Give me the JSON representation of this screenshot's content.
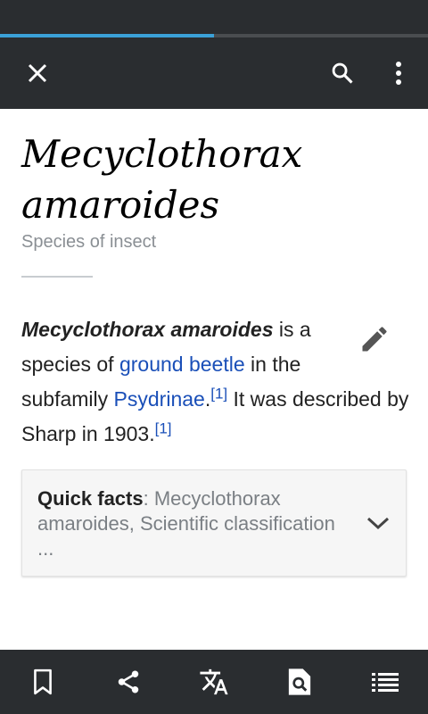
{
  "browser": {
    "load_progress_percent": 50
  },
  "toolbar": {
    "close_icon": "close-icon",
    "search_icon": "search-icon",
    "menu_icon": "more-vert-icon"
  },
  "article": {
    "title": "Mecyclothorax amaroides",
    "description": "Species of insect",
    "lead": {
      "bold_name": "Mecyclothorax amaroides",
      "text_1": " is a species of ",
      "link_1": "ground beetle",
      "text_2": " in the subfamily ",
      "link_2": "Psydrinae",
      "text_3": ".",
      "ref_1": "[1]",
      "text_4": " It was described by Sharp in 1903.",
      "ref_2": "[1]"
    },
    "edit_icon": "pencil-icon",
    "quick_facts": {
      "label": "Quick facts",
      "separator": ": ",
      "summary": "Mecyclothorax amaroides, Scientific classification ...",
      "expand_icon": "chevron-down-icon"
    }
  },
  "bottom_bar": {
    "icons": [
      "bookmark-icon",
      "share-icon",
      "translate-icon",
      "find-in-page-icon",
      "table-of-contents-icon"
    ]
  },
  "colors": {
    "bar_bg": "#2a2d30",
    "progress": "#3ba1d8",
    "link": "#1a4fb8"
  }
}
